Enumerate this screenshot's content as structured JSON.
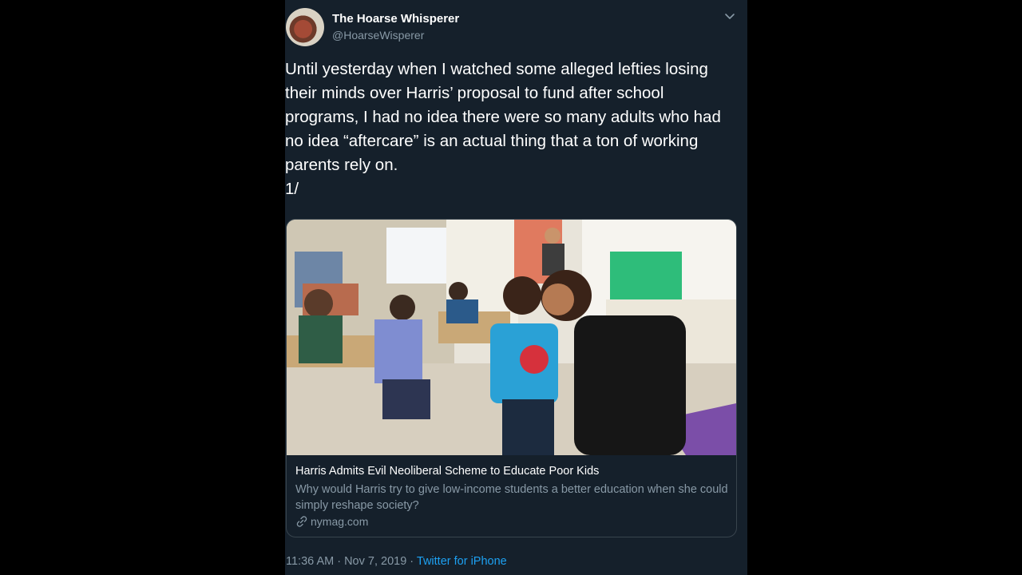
{
  "author": {
    "display_name": "The Hoarse Whisperer",
    "handle": "@HoarseWisperer"
  },
  "tweet": {
    "text": "Until yesterday when I watched some alleged lefties losing their minds over Harris’ proposal to fund after school programs, I had no idea there were so many adults who had no idea “aftercare” is an actual thing that a ton of working parents rely on.\n1/"
  },
  "link_card": {
    "title": "Harris Admits Evil Neoliberal Scheme to Educate Poor Kids",
    "description": "Why would Harris try to give low-income students a better education when she could simply reshape society?",
    "domain": "nymag.com",
    "link_icon": "link-icon"
  },
  "meta": {
    "timestamp": "11:36 AM · Nov 7, 2019",
    "separator": " · ",
    "source": "Twitter for iPhone"
  },
  "colors": {
    "background": "#15202b",
    "secondary_text": "#8899a6",
    "accent": "#1da1f2",
    "border": "#38444d"
  }
}
